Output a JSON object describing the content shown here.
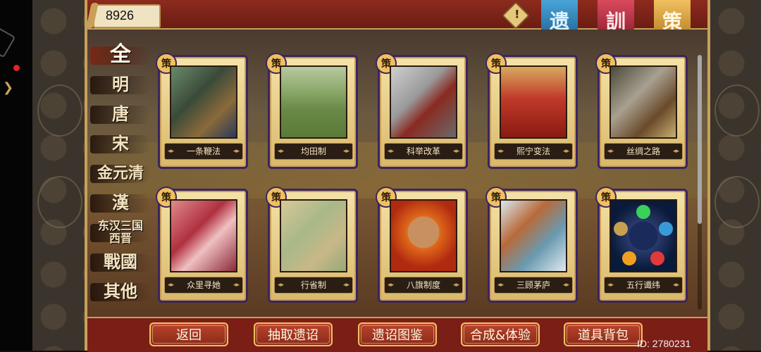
{
  "currency": {
    "amount": "8926"
  },
  "alert_icon": "exclamation-diamond-icon",
  "category_tabs": [
    {
      "label": "遗",
      "color": "#2f7fb8"
    },
    {
      "label": "訓",
      "color": "#b22a3c"
    },
    {
      "label": "策",
      "color": "#e0a030"
    }
  ],
  "dynasties": [
    {
      "label": "全",
      "active": true
    },
    {
      "label": "明"
    },
    {
      "label": "唐"
    },
    {
      "label": "宋"
    },
    {
      "label": "金元清"
    },
    {
      "label": "漢"
    },
    {
      "label": "东汉三国\n西晋"
    },
    {
      "label": "戰國"
    },
    {
      "label": "其他"
    }
  ],
  "cards": [
    {
      "badge": "策",
      "name": "一条鞭法"
    },
    {
      "badge": "策",
      "name": "均田制"
    },
    {
      "badge": "策",
      "name": "科举改革"
    },
    {
      "badge": "策",
      "name": "熙宁变法"
    },
    {
      "badge": "策",
      "name": "丝绸之路"
    },
    {
      "badge": "策",
      "name": "众里寻她"
    },
    {
      "badge": "策",
      "name": "行省制"
    },
    {
      "badge": "策",
      "name": "八旗制度"
    },
    {
      "badge": "策",
      "name": "三顾茅庐"
    },
    {
      "badge": "策",
      "name": "五行谶纬"
    }
  ],
  "buttons": {
    "back": "返回",
    "draw": "抽取遗诏",
    "catalog": "遗诏图鉴",
    "synthesize": "合成&体验",
    "bag": "道具背包"
  },
  "user_id": "ID: 2780231"
}
